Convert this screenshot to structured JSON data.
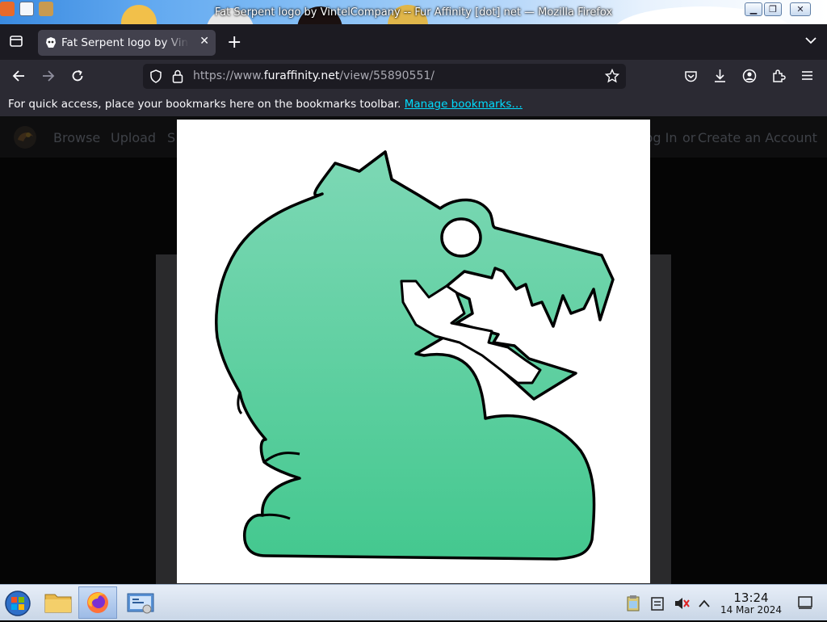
{
  "window": {
    "title": "Fat Serpent logo by VintelCompany -- Fur Affinity [dot] net — Mozilla Firefox"
  },
  "tabs": [
    {
      "title": "Fat Serpent logo by VintelCompany -- Fur Affinity [dot] net",
      "active": true
    }
  ],
  "navbar": {
    "url_prefix": "https://www.",
    "url_host": "furaffinity.net",
    "url_path": "/view/55890551/"
  },
  "bookmarks_bar": {
    "message": "For quick access, place your bookmarks here on the bookmarks toolbar.",
    "link": "Manage bookmarks…"
  },
  "site_nav": {
    "browse": "Browse",
    "upload": "Upload",
    "search_partial": "S",
    "login": "Log In",
    "or": "or",
    "create_account": "Create an Account"
  },
  "artwork": {
    "body_color_top": "#7dd8b5",
    "body_color_bottom": "#44c88f",
    "outline_color": "#000000"
  },
  "taskbar": {
    "time": "13:24",
    "date": "14 Mar 2024"
  },
  "colors": {
    "chrome_dark": "#1c1b22",
    "chrome_toolbar": "#2b2a33",
    "link_cyan": "#00ddff"
  }
}
